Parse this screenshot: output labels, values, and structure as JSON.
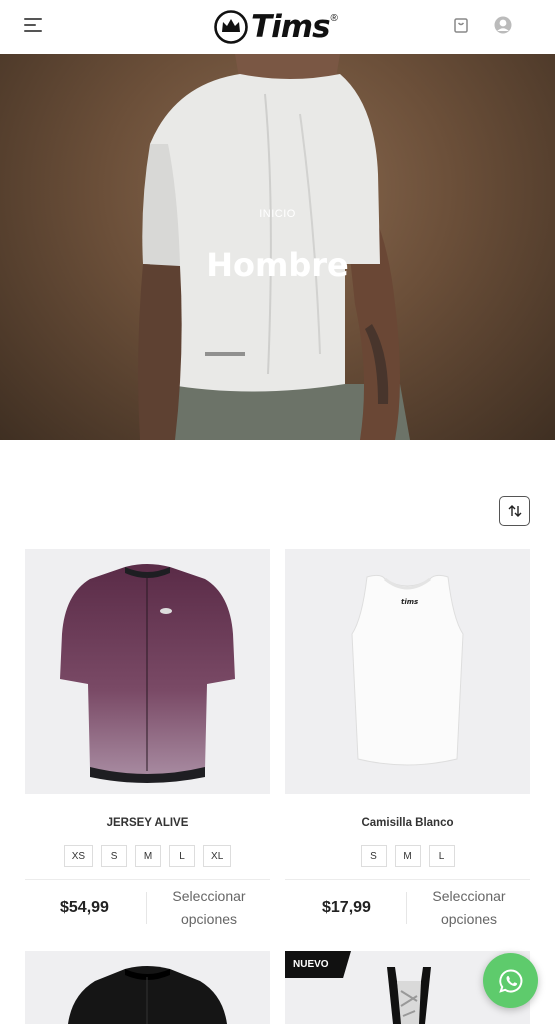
{
  "header": {
    "logo_text": "Tims",
    "logo_mark": "®"
  },
  "hero": {
    "breadcrumb": "INICIO",
    "title": "Hombre"
  },
  "products": [
    {
      "name": "JERSEY ALIVE",
      "sizes": [
        "XS",
        "S",
        "M",
        "L",
        "XL"
      ],
      "price": "$54,99",
      "action": "Seleccionar opciones"
    },
    {
      "name": "Camisilla Blanco",
      "sizes": [
        "S",
        "M",
        "L"
      ],
      "price": "$17,99",
      "action": "Seleccionar opciones"
    },
    {
      "badge": ""
    },
    {
      "badge": "NUEVO"
    }
  ],
  "colors": {
    "whatsapp": "#5ecb6c",
    "jersey": "#6e3656"
  },
  "icons": [
    "menu-icon",
    "bag-icon",
    "user-icon",
    "sort-icon",
    "whatsapp-icon"
  ]
}
